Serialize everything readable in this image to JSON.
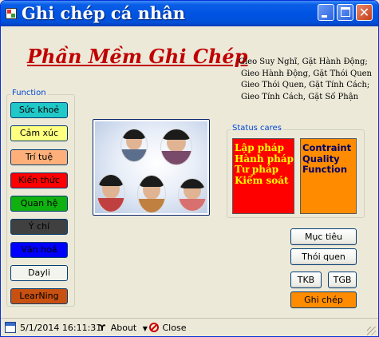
{
  "window": {
    "title": "Ghi chép cá nhân",
    "controls": {
      "minimize": "",
      "maximize": "",
      "close": "✕"
    }
  },
  "header": {
    "app_title": "Phần Mềm Ghi Chép",
    "motto": [
      "Gieo Suy Nghĩ, Gặt Hành Động;",
      "Gieo Hành Động, Gặt Thói Quen",
      "Gieo Thói Quen, Gặt Tính Cách;",
      "Gieo Tính Cách, Gặt Số Phận"
    ]
  },
  "function_group": {
    "label": "Function",
    "buttons": [
      {
        "label": "Sức khoẻ",
        "bg": "#20c8c8",
        "fg": "#000000"
      },
      {
        "label": "Cảm xúc",
        "bg": "#ffff80",
        "fg": "#000000"
      },
      {
        "label": "Trí tuệ",
        "bg": "#ffb07a",
        "fg": "#000000"
      },
      {
        "label": "Kiến thức",
        "bg": "#ff0000",
        "fg": "#000000"
      },
      {
        "label": "Quan hệ",
        "bg": "#10b010",
        "fg": "#000000"
      },
      {
        "label": "Ý chí",
        "bg": "#404040",
        "fg": "#000000"
      },
      {
        "label": "Văn hoá",
        "bg": "#0000ff",
        "fg": "#000000"
      },
      {
        "label": "Dayli",
        "bg": "#f4f4ee",
        "fg": "#000000"
      },
      {
        "label": "LearNing",
        "bg": "#c85010",
        "fg": "#000000"
      }
    ]
  },
  "status_group": {
    "label": "Status cares",
    "left_items": [
      "Lập pháp",
      "Hành pháp",
      "Tư pháp",
      "Kiểm soát"
    ],
    "right_items": [
      "Contraint",
      "Quality",
      "Function"
    ]
  },
  "actions": {
    "muc_tieu": "Mục tiêu",
    "thoi_quen": "Thói quen",
    "tkb": "TKB",
    "tgb": "TGB",
    "ghi_chep": "Ghi chép"
  },
  "statusbar": {
    "datetime": "5/1/2014 16:11:31",
    "about": "About",
    "close": "Close"
  },
  "colors": {
    "title_red": "#c00000",
    "group_label_blue": "#0046d5",
    "ghi_chep_orange": "#ff8c00"
  }
}
